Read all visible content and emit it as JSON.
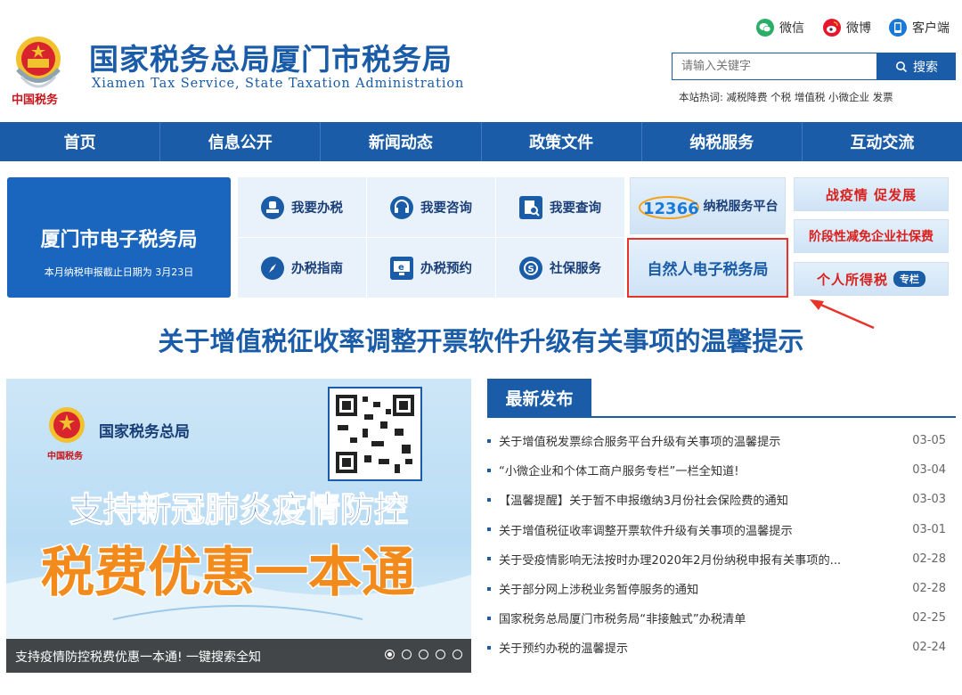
{
  "header": {
    "title": "国家税务总局厦门市税务局",
    "subtitle": "Xiamen Tax Service, State Taxation Administration",
    "logo_text": "中国税务",
    "social": [
      {
        "label": "微信",
        "icon": "wechat-icon",
        "color": "#2aae67"
      },
      {
        "label": "微博",
        "icon": "weibo-icon",
        "color": "#e6162d"
      },
      {
        "label": "客户端",
        "icon": "mobile-app-icon",
        "color": "#1a79d8"
      }
    ],
    "search": {
      "placeholder": "请输入关键字",
      "button_label": "搜索"
    },
    "hot_words": "本站热词: 减税降费 个税 增值税 小微企业 发票"
  },
  "nav": [
    "首页",
    "信息公开",
    "新闻动态",
    "政策文件",
    "纳税服务",
    "互动交流"
  ],
  "etax": {
    "title": "厦门市电子税务局",
    "subtitle": "本月纳税申报截止日期为 3月23日"
  },
  "services": [
    {
      "label": "我要办税",
      "icon": "stamp-icon"
    },
    {
      "label": "我要咨询",
      "icon": "headset-icon"
    },
    {
      "label": "我要查询",
      "icon": "document-search-icon"
    },
    {
      "label": "办税指南",
      "icon": "compass-icon"
    },
    {
      "label": "办税预约",
      "icon": "monitor-icon"
    },
    {
      "label": "社保服务",
      "icon": "social-security-icon"
    }
  ],
  "platforms": {
    "hotline": "12366",
    "service_platform": "纳税服务平台",
    "natural_person": "自然人电子税务局",
    "banners": [
      "战疫情 促发展",
      "阶段性减免企业社保费",
      "个人所得税"
    ],
    "special_badge": "专栏"
  },
  "headline": "关于增值税征收率调整开票软件升级有关事项的温馨提示",
  "carousel": {
    "logo_text": "国家税务总局",
    "logo_small": "中国税务",
    "line1": "支持新冠肺炎疫情防控",
    "line2": "税费优惠一本通",
    "caption": "支持疫情防控税费优惠一本通! 一键搜索全知",
    "dots": 5,
    "active": 0
  },
  "news": {
    "tab": "最新发布",
    "items": [
      {
        "title": "关于增值税发票综合服务平台升级有关事项的温馨提示",
        "date": "03-05"
      },
      {
        "title": "“小微企业和个体工商户服务专栏”一栏全知道!",
        "date": "03-04"
      },
      {
        "title": "【温馨提醒】关于暂不申报缴纳3月份社会保险费的通知",
        "date": "03-03"
      },
      {
        "title": "关于增值税征收率调整开票软件升级有关事项的温馨提示",
        "date": "03-01"
      },
      {
        "title": "关于受疫情影响无法按时办理2020年2月份纳税申报有关事项的...",
        "date": "02-28"
      },
      {
        "title": "关于部分网上涉税业务暂停服务的通知",
        "date": "02-28"
      },
      {
        "title": "国家税务总局厦门市税务局“非接触式”办税清单",
        "date": "02-25"
      },
      {
        "title": "关于预约办税的温馨提示",
        "date": "02-24"
      }
    ]
  }
}
